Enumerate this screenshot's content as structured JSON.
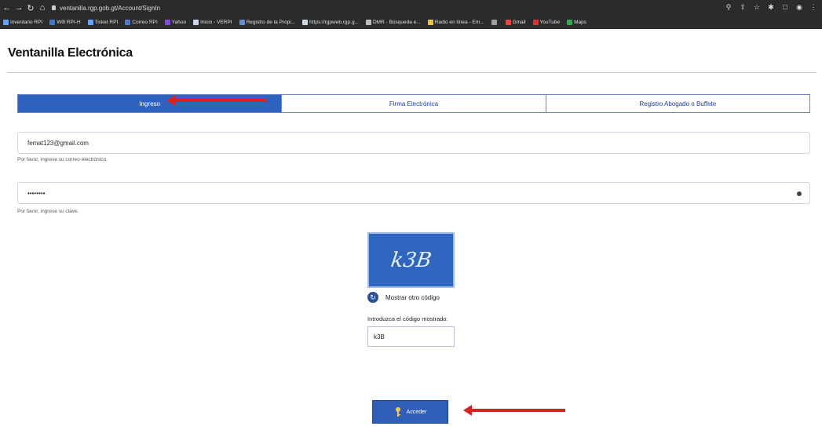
{
  "browser": {
    "url": "ventanilla.rgp.gob.gt/Account/SignIn",
    "bookmarks": [
      {
        "label": "Inventario RPI",
        "color": "#6aa0ff"
      },
      {
        "label": "Wifi RPI-H",
        "color": "#3b79d8"
      },
      {
        "label": "Ticket RPI",
        "color": "#6aa0ff"
      },
      {
        "label": "Correo RPI",
        "color": "#4a7ed6"
      },
      {
        "label": "Yahoo",
        "color": "#7c4dd8"
      },
      {
        "label": "Inicio - VERPI",
        "color": "#cfd5e6"
      },
      {
        "label": "Registro de la Propi...",
        "color": "#5b8fe0"
      },
      {
        "label": "https://rgpweb.rgp.g...",
        "color": "#cfd5e6"
      },
      {
        "label": "DMR - Búsqueda e...",
        "color": "#bdbdbd"
      },
      {
        "label": "Radio en línea - Em...",
        "color": "#f1c232"
      },
      {
        "label": "",
        "color": "#9e9e9e"
      },
      {
        "label": "Gmail",
        "color": "#e8453c"
      },
      {
        "label": "YouTube",
        "color": "#e52d27"
      },
      {
        "label": "Maps",
        "color": "#34a853"
      }
    ]
  },
  "page": {
    "title": "Ventanilla Electrónica"
  },
  "tabs": [
    {
      "label": "Ingreso",
      "active": true
    },
    {
      "label": "Firma Electrónica",
      "active": false
    },
    {
      "label": "Registro Abogado o Buffete",
      "active": false
    }
  ],
  "form": {
    "email_value": "femat123@gmail.com",
    "email_help": "Por favor, ingrese su correo electrónico.",
    "password_value": "••••••••",
    "password_help": "Por favor, ingrese su clave.",
    "captcha_text": "k3B",
    "refresh_label": "Mostrar otro código",
    "code_label": "Introduzca el código mostrado:",
    "code_value": "k3B",
    "submit_label": "Acceder"
  },
  "colors": {
    "accent": "#2f63c2",
    "annotation_arrow": "#d8221f"
  }
}
